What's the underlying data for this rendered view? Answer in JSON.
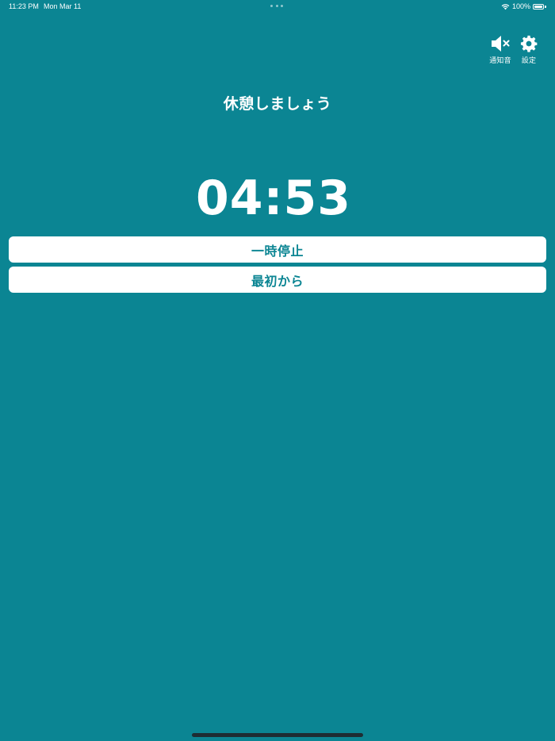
{
  "status_bar": {
    "time": "11:23 PM",
    "date": "Mon Mar 11",
    "battery": "100%"
  },
  "toolbar": {
    "mute_label": "通知音",
    "settings_label": "設定"
  },
  "main": {
    "heading": "休憩しましょう",
    "timer": "04:53",
    "pause_label": "一時停止",
    "restart_label": "最初から"
  },
  "colors": {
    "background": "#0b8593",
    "button_bg": "#ffffff",
    "button_text": "#0b8593"
  },
  "icons": {
    "mute": "speaker-muted-icon",
    "settings": "gear-icon",
    "wifi": "wifi-icon",
    "battery": "battery-icon"
  }
}
